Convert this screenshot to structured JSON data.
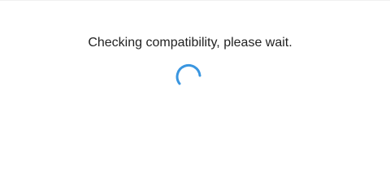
{
  "dialog": {
    "message": "Checking compatibility, please wait."
  },
  "spinner": {
    "icon": "loading-spinner-icon",
    "color": "#3a96e0"
  }
}
